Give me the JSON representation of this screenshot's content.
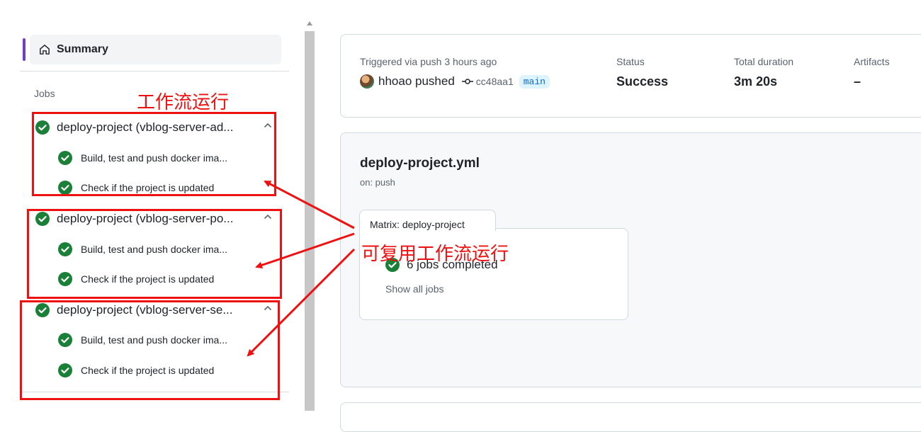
{
  "sidebar": {
    "summary_label": "Summary",
    "jobs_heading": "Jobs",
    "jobs": [
      {
        "label": "deploy-project (vblog-server-ad...",
        "steps": [
          "Build, test and push docker ima...",
          "Check if the project is updated"
        ]
      },
      {
        "label": "deploy-project (vblog-server-po...",
        "steps": [
          "Build, test and push docker ima...",
          "Check if the project is updated"
        ]
      },
      {
        "label": "deploy-project (vblog-server-se...",
        "steps": [
          "Build, test and push docker ima...",
          "Check if the project is updated"
        ]
      }
    ]
  },
  "run_info": {
    "trigger": "Triggered via push 3 hours ago",
    "user": "hhoao",
    "pushed": "pushed",
    "commit": "cc48aa1",
    "branch": "main",
    "status_caption": "Status",
    "status_value": "Success",
    "duration_caption": "Total duration",
    "duration_value": "3m 20s",
    "artifacts_caption": "Artifacts",
    "artifacts_value": "–"
  },
  "workflow": {
    "file": "deploy-project.yml",
    "event": "on: push",
    "matrix_title": "Matrix: deploy-project",
    "completed": "6 jobs completed",
    "show_all": "Show all jobs"
  },
  "annotations": {
    "workflow_runs": "工作流运行",
    "reusable_runs": "可复用工作流运行",
    "color": "#ee1111"
  },
  "colors": {
    "success": "#1a7f37",
    "accent": "#6e40c9",
    "branch_bg": "#ddf4ff",
    "branch_fg": "#0969da"
  }
}
